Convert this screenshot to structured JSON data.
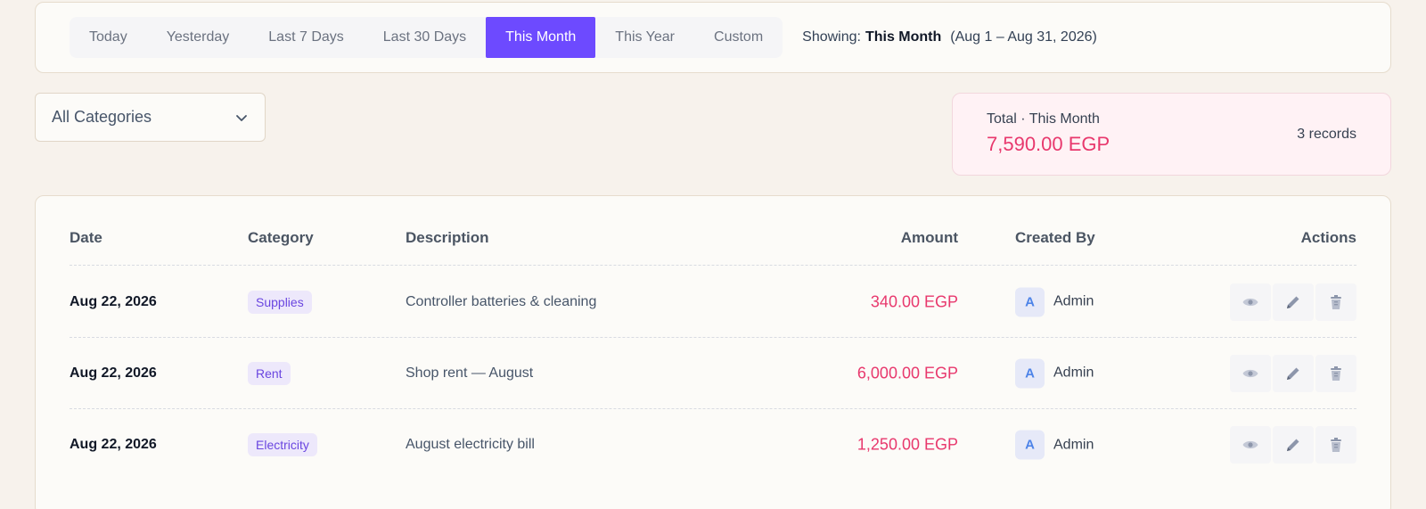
{
  "filters": {
    "tabs": [
      "Today",
      "Yesterday",
      "Last 7 Days",
      "Last 30 Days",
      "This Month",
      "This Year",
      "Custom"
    ],
    "active_tab": "This Month",
    "showing_label": "Showing:",
    "showing_value": "This Month",
    "showing_range": "(Aug 1 – Aug 31, 2026)"
  },
  "category_select": {
    "value": "All Categories"
  },
  "summary": {
    "label": "Total · This Month",
    "total": "7,590.00 EGP",
    "records": "3 records"
  },
  "table": {
    "headers": {
      "date": "Date",
      "category": "Category",
      "description": "Description",
      "amount": "Amount",
      "created_by": "Created By",
      "actions": "Actions"
    },
    "rows": [
      {
        "date": "Aug 22, 2026",
        "category": "Supplies",
        "description": "Controller batteries & cleaning",
        "amount": "340.00 EGP",
        "avatar": "A",
        "created_by": "Admin"
      },
      {
        "date": "Aug 22, 2026",
        "category": "Rent",
        "description": "Shop rent — August",
        "amount": "6,000.00 EGP",
        "avatar": "A",
        "created_by": "Admin"
      },
      {
        "date": "Aug 22, 2026",
        "category": "Electricity",
        "description": "August electricity bill",
        "amount": "1,250.00 EGP",
        "avatar": "A",
        "created_by": "Admin"
      }
    ]
  },
  "colors": {
    "accent": "#6d4aff",
    "amount": "#e8386d",
    "badge_bg": "#ede8fb",
    "icon": "#9aa3b8"
  },
  "icons": {
    "view": "eye-icon",
    "edit": "pencil-icon",
    "delete": "trash-icon",
    "dropdown": "chevron-down-icon"
  }
}
